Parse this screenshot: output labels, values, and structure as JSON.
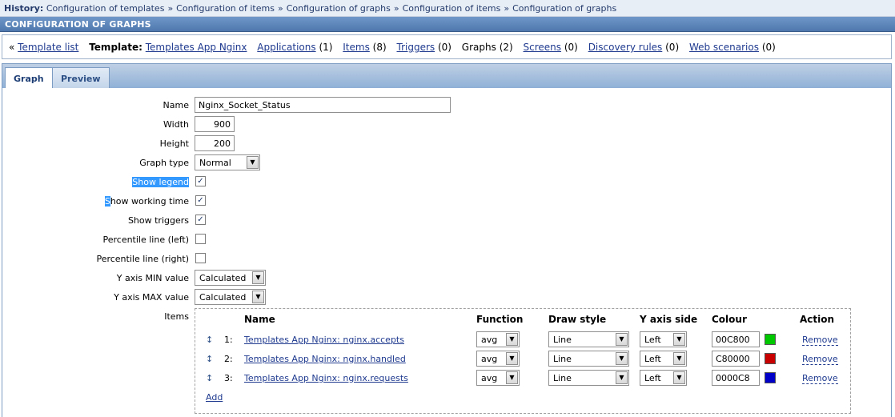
{
  "history": {
    "label": "History:",
    "items": [
      "Configuration of templates",
      "Configuration of items",
      "Configuration of graphs",
      "Configuration of items",
      "Configuration of graphs"
    ],
    "separator": "»"
  },
  "section_title": "CONFIGURATION OF GRAPHS",
  "template_nav": {
    "back_arrow": "«",
    "template_list": "Template list",
    "template_label": "Template:",
    "template_name": "Templates App Nginx",
    "applications": "Applications",
    "applications_count": "(1)",
    "items": "Items",
    "items_count": "(8)",
    "triggers": "Triggers",
    "triggers_count": "(0)",
    "graphs": "Graphs",
    "graphs_count": "(2)",
    "screens": "Screens",
    "screens_count": "(0)",
    "discovery": "Discovery rules",
    "discovery_count": "(0)",
    "web": "Web scenarios",
    "web_count": "(0)"
  },
  "tabs": {
    "graph": "Graph",
    "preview": "Preview"
  },
  "form": {
    "name_label": "Name",
    "name_value": "Nginx_Socket_Status",
    "width_label": "Width",
    "width_value": "900",
    "height_label": "Height",
    "height_value": "200",
    "graph_type_label": "Graph type",
    "graph_type_value": "Normal",
    "show_legend_label": "Show legend",
    "show_legend_checked": true,
    "show_working_time_label_first": "S",
    "show_working_time_label_rest": "how working time",
    "show_working_time_checked": true,
    "show_triggers_label": "Show triggers",
    "show_triggers_checked": true,
    "pct_left_label": "Percentile line (left)",
    "pct_left_checked": false,
    "pct_right_label": "Percentile line (right)",
    "pct_right_checked": false,
    "ymin_label": "Y axis MIN value",
    "ymin_value": "Calculated",
    "ymax_label": "Y axis MAX value",
    "ymax_value": "Calculated",
    "items_label": "Items"
  },
  "items_table": {
    "headers": {
      "name": "Name",
      "function": "Function",
      "draw_style": "Draw style",
      "y_axis_side": "Y axis side",
      "colour": "Colour",
      "action": "Action"
    },
    "rows": [
      {
        "num": "1:",
        "name": "Templates App Nginx: nginx.accepts",
        "function": "avg",
        "draw_style": "Line",
        "y_axis": "Left",
        "colour": "00C800",
        "colour_hex": "#00C800",
        "action": "Remove"
      },
      {
        "num": "2:",
        "name": "Templates App Nginx: nginx.handled",
        "function": "avg",
        "draw_style": "Line",
        "y_axis": "Left",
        "colour": "C80000",
        "colour_hex": "#C80000",
        "action": "Remove"
      },
      {
        "num": "3:",
        "name": "Templates App Nginx: nginx.requests",
        "function": "avg",
        "draw_style": "Line",
        "y_axis": "Left",
        "colour": "0000C8",
        "colour_hex": "#0000C8",
        "action": "Remove"
      }
    ],
    "add_label": "Add"
  }
}
